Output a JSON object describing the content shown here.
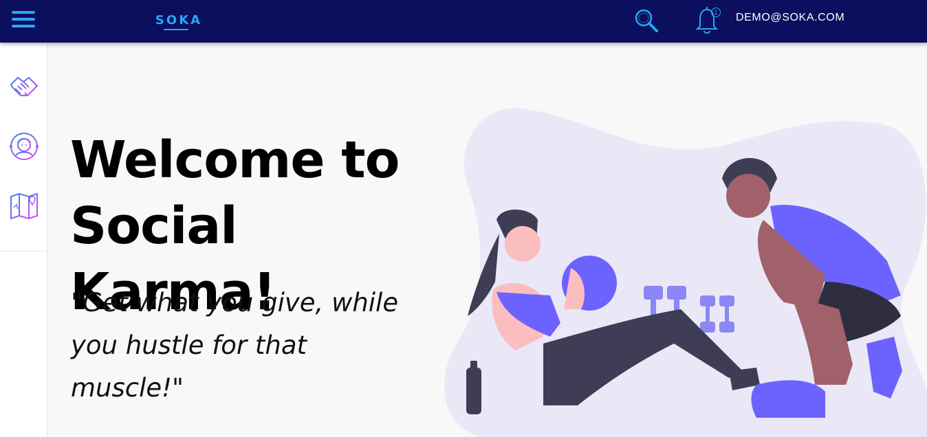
{
  "header": {
    "logo_text": "SOKA",
    "menu_icon": "hamburger-menu-icon",
    "search_icon": "search-icon",
    "notification_icon": "bell-icon",
    "notification_count": "1",
    "user_email": "DEMO@SOKA.COM"
  },
  "sidebar": {
    "items": [
      {
        "icon": "handshake-icon"
      },
      {
        "icon": "user-profile-icon"
      },
      {
        "icon": "map-location-icon"
      }
    ]
  },
  "hero": {
    "heading_line1": "Welcome to",
    "heading_line2": "Social Karma!",
    "quote": "\"Get what you give, while you hustle for that muscle!\""
  },
  "colors": {
    "header_bg": "#0b0f5e",
    "accent_blue": "#29a6f5",
    "icon_gradient_start": "#3b82f6",
    "icon_gradient_end": "#d946ef",
    "illustration_primary": "#6c63ff"
  }
}
